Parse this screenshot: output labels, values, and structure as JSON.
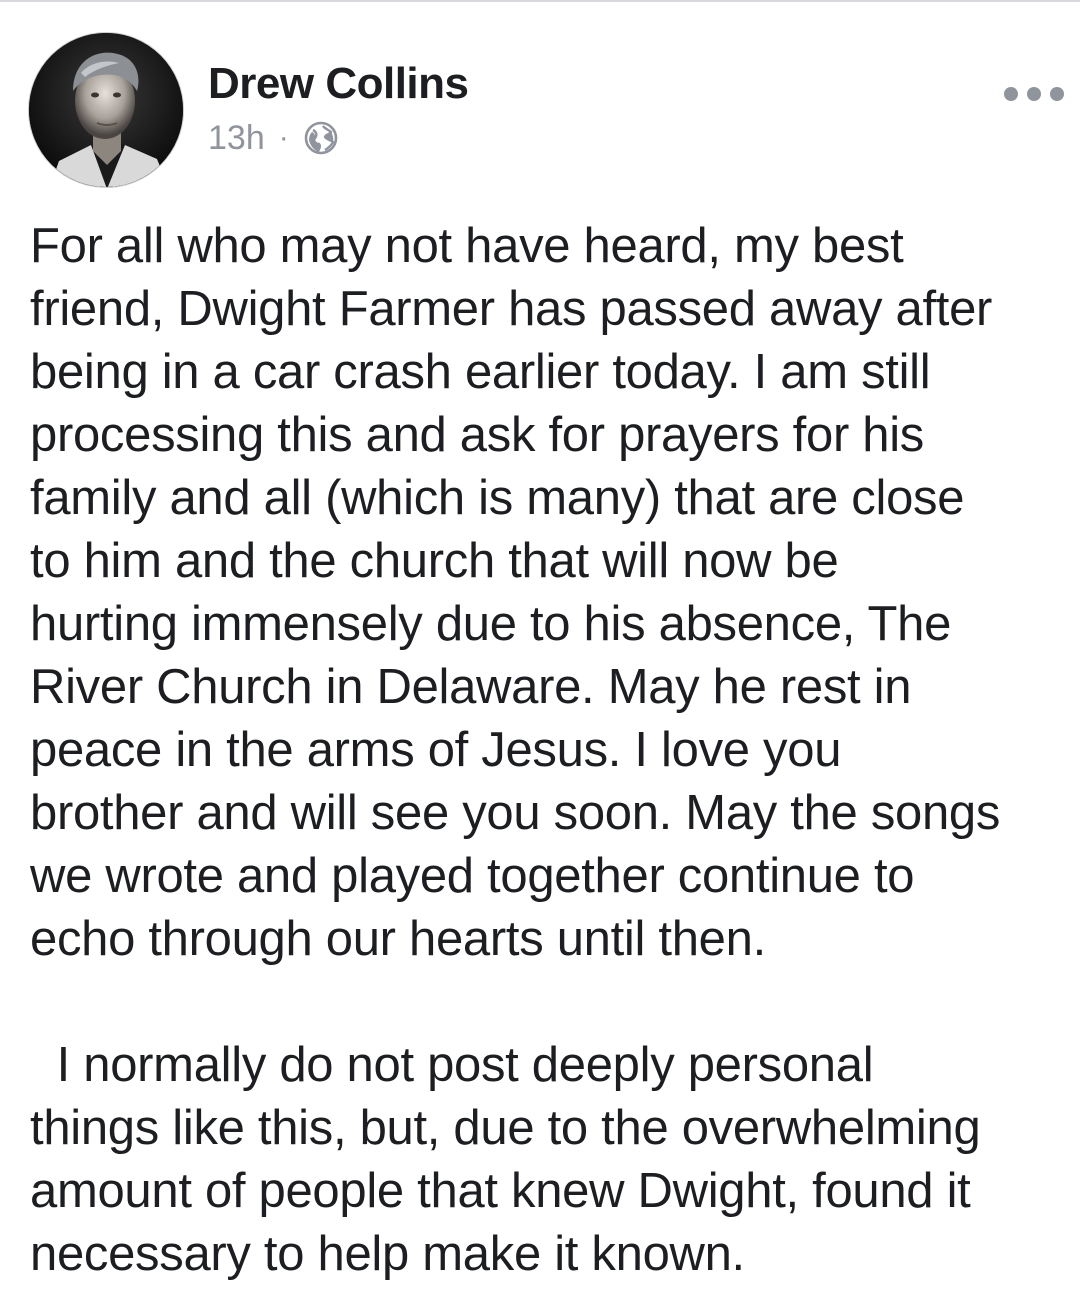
{
  "post": {
    "author": "Drew Collins",
    "timestamp": "13h",
    "separator": "·",
    "privacy_icon": "globe-icon",
    "more_icon": "more-options-icon",
    "paragraphs": [
      {
        "lines": [
          "For all who may not have heard, my best",
          "friend, Dwight Farmer has passed away after",
          "being in a car crash earlier today. I am still",
          "processing this and ask for prayers for his",
          "family and all (which is many) that are close",
          "to him and the church that will now be",
          "hurting immensely due to his absence, The",
          "River Church in Delaware. May he rest in",
          "peace in the arms of Jesus. I love you",
          "brother and will see you soon. May the songs",
          "we wrote and played together continue to",
          "echo through our hearts until then."
        ]
      },
      {
        "lines": [
          "  I normally do not post deeply personal",
          "things like this, but, due to the overwhelming",
          "amount of people that knew Dwight, found it",
          "necessary to help make it known."
        ]
      }
    ]
  },
  "colors": {
    "text": "#1c1e21",
    "meta": "#90949c",
    "background": "#ffffff"
  }
}
